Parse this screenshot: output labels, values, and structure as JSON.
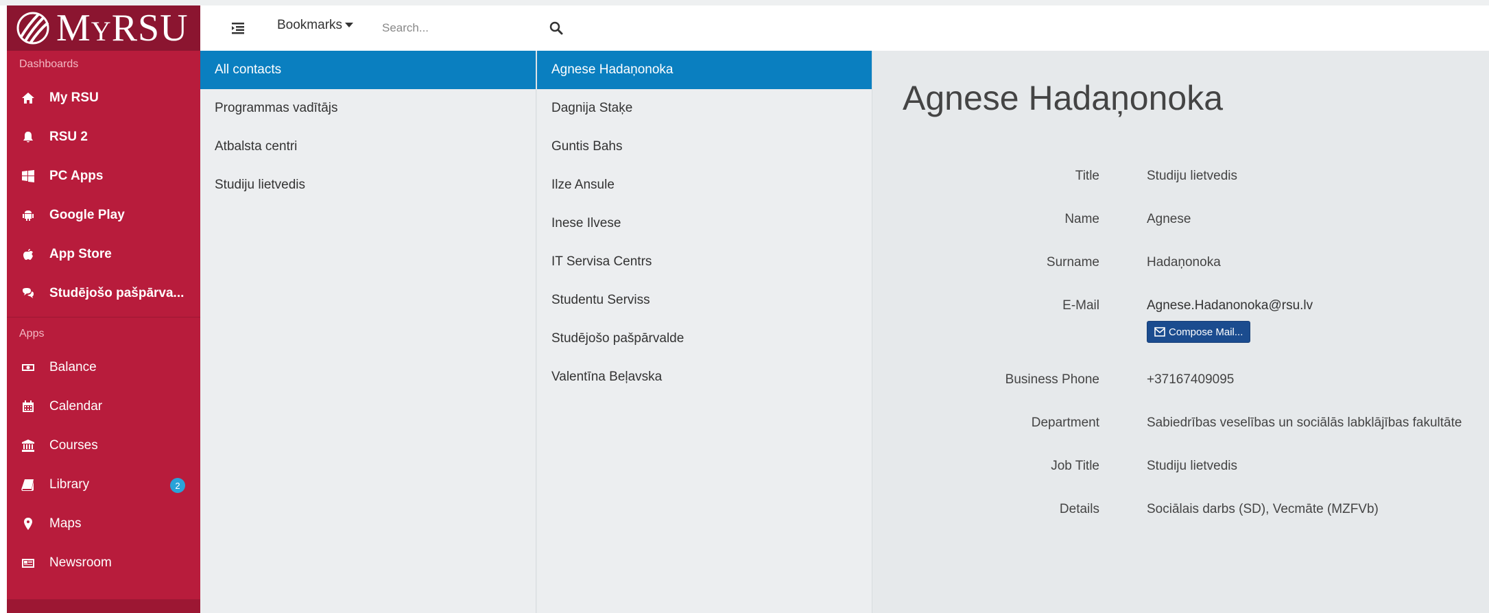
{
  "app": {
    "logo_text_big": "M",
    "logo_text_small": "Y",
    "logo_text_rest": "RSU"
  },
  "sidebar": {
    "dashboards_label": "Dashboards",
    "apps_label": "Apps",
    "dashboards": [
      {
        "label": "My RSU",
        "icon": "home-icon"
      },
      {
        "label": "RSU 2",
        "icon": "bell-icon"
      },
      {
        "label": "PC Apps",
        "icon": "windows-icon"
      },
      {
        "label": "Google Play",
        "icon": "android-icon"
      },
      {
        "label": "App Store",
        "icon": "apple-icon"
      },
      {
        "label": "Studējošo pašpārva...",
        "icon": "chat-icon"
      }
    ],
    "apps": [
      {
        "label": "Balance",
        "icon": "money-icon"
      },
      {
        "label": "Calendar",
        "icon": "calendar-icon"
      },
      {
        "label": "Courses",
        "icon": "institution-icon"
      },
      {
        "label": "Library",
        "icon": "book-icon",
        "badge": "2"
      },
      {
        "label": "Maps",
        "icon": "map-marker-icon"
      },
      {
        "label": "Newsroom",
        "icon": "newspaper-icon"
      }
    ]
  },
  "topbar": {
    "bookmarks_label": "Bookmarks",
    "search_placeholder": "Search..."
  },
  "groups": [
    "All contacts",
    "Programmas vadītājs",
    "Atbalsta centri",
    "Studiju lietvedis"
  ],
  "contacts": [
    "Agnese Hadaņonoka",
    "Dagnija Staķe",
    "Guntis Bahs",
    "Ilze Ansule",
    "Inese Ilvese",
    "IT Servisa Centrs",
    "Studentu Serviss",
    "Studējošo pašpārvalde",
    "Valentīna Beļavska"
  ],
  "detail": {
    "name": "Agnese Hadaņonoka",
    "fields": [
      {
        "label": "Title",
        "value": "Studiju lietvedis"
      },
      {
        "label": "Name",
        "value": "Agnese"
      },
      {
        "label": "Surname",
        "value": "Hadaņonoka"
      },
      {
        "label": "E-Mail",
        "value": "Agnese.Hadanonoka@rsu.lv"
      },
      {
        "label": "Business Phone",
        "value": "+37167409095"
      },
      {
        "label": "Department",
        "value": "Sabiedrības veselības un sociālās labklājības fakultāte"
      },
      {
        "label": "Job Title",
        "value": "Studiju lietvedis"
      },
      {
        "label": "Details",
        "value": "Sociālais darbs (SD), Vecmāte (MZFVb)"
      }
    ],
    "compose_label": "Compose Mail..."
  },
  "colors": {
    "sidebar": "#b81c3c",
    "logo_bg": "#8b1530",
    "active": "#0a7fc0",
    "compose": "#1b4c8f",
    "badge": "#29a3d9"
  }
}
